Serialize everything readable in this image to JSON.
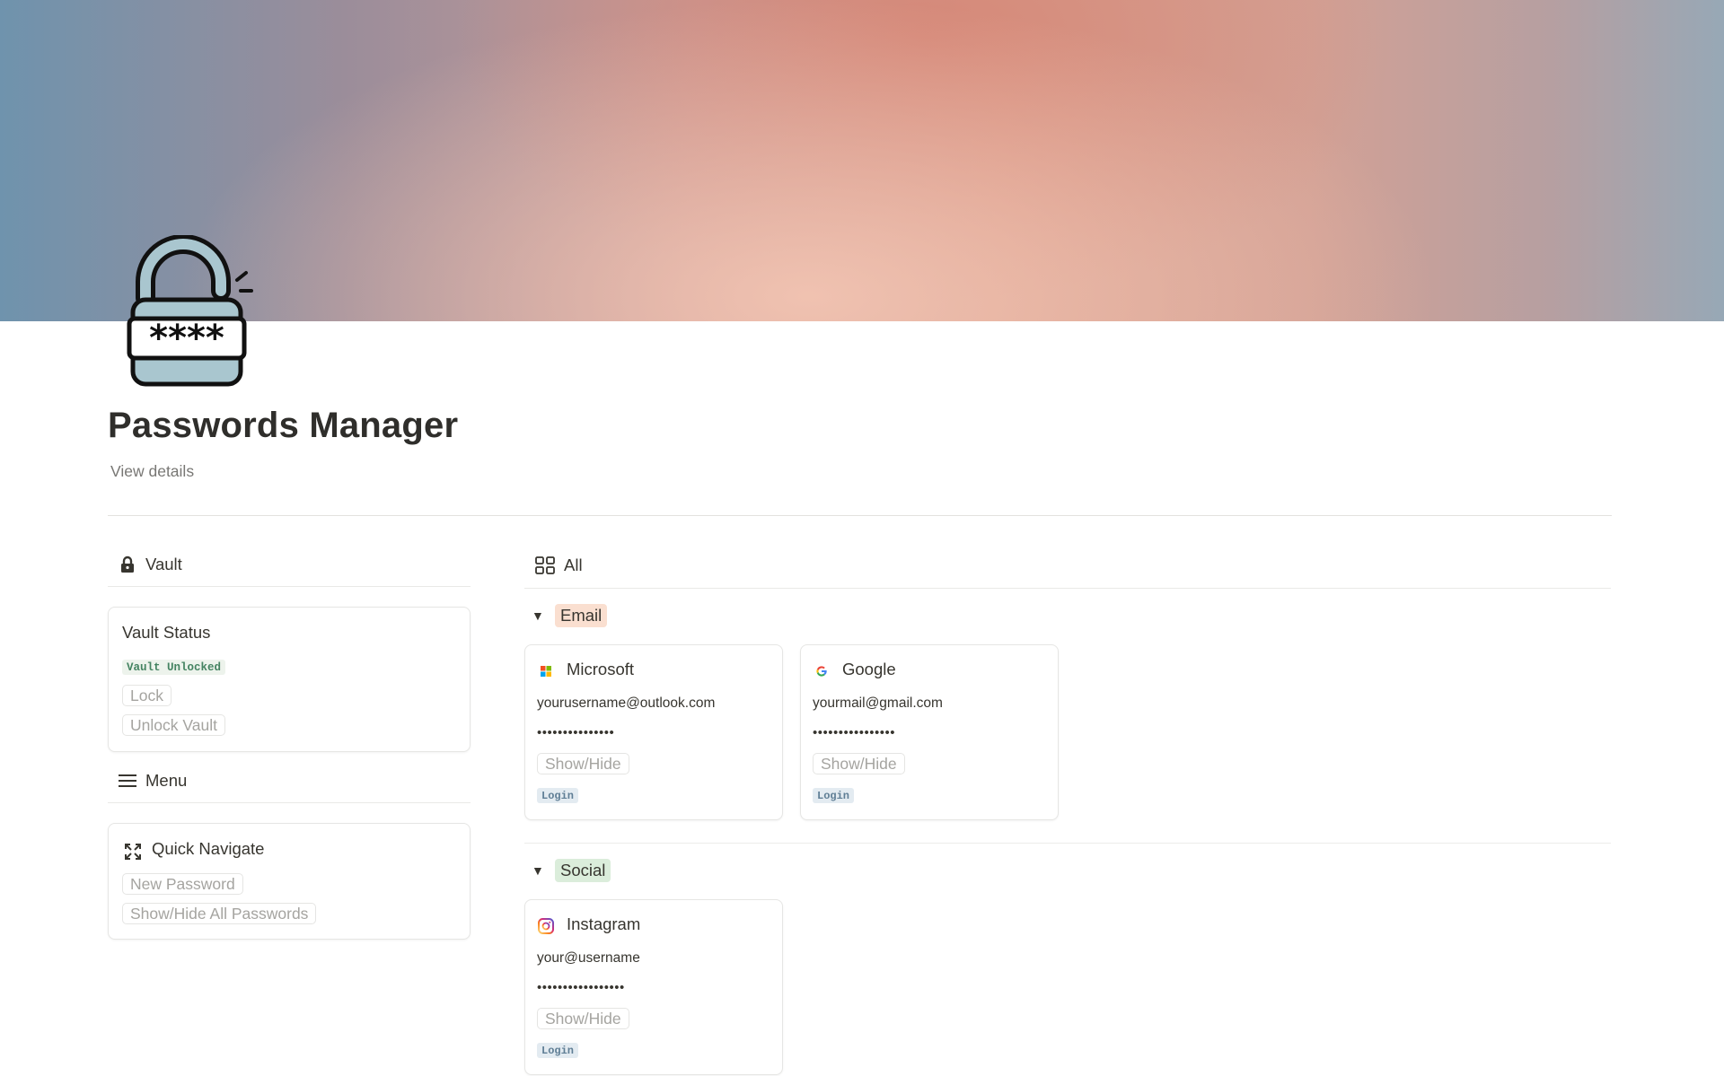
{
  "page": {
    "title": "Passwords Manager",
    "view_details": "View details",
    "icon": "open-padlock-password-icon",
    "icon_text": "****"
  },
  "vault_section": {
    "heading": "Vault",
    "icon": "lock-icon",
    "card": {
      "title": "Vault Status",
      "status_tag": "Vault Unlocked",
      "lock_button": "Lock",
      "unlock_button": "Unlock Vault"
    }
  },
  "menu_section": {
    "heading": "Menu",
    "icon": "hamburger-menu-icon",
    "card": {
      "title": "Quick Navigate",
      "icon": "expand-arrows-icon",
      "new_password_button": "New Password",
      "show_hide_all_button": "Show/Hide All Passwords"
    }
  },
  "gallery": {
    "view_label": "All",
    "view_icon": "gallery-grid-icon",
    "groups": [
      {
        "label": "Email",
        "tag_color": "#fadfd0",
        "cards": [
          {
            "name": "Microsoft",
            "icon": "microsoft-logo-icon",
            "username": "yourusername@outlook.com",
            "password_mask": "•••••••••••••••",
            "toggle": "Show/Hide",
            "login": "Login"
          },
          {
            "name": "Google",
            "icon": "google-logo-icon",
            "username": "yourmail@gmail.com",
            "password_mask": "••••••••••••••••",
            "toggle": "Show/Hide",
            "login": "Login"
          }
        ]
      },
      {
        "label": "Social",
        "tag_color": "#dbeddb",
        "cards": [
          {
            "name": "Instagram",
            "icon": "instagram-logo-icon",
            "username": "your@username",
            "password_mask": "•••••••••••••••••",
            "toggle": "Show/Hide",
            "login": "Login"
          }
        ]
      }
    ]
  },
  "colors": {
    "status_tag_bg": "#edf3ec",
    "status_tag_text": "#448361",
    "login_tag_bg": "#e3ebf1",
    "login_tag_text": "#5f7e95"
  }
}
